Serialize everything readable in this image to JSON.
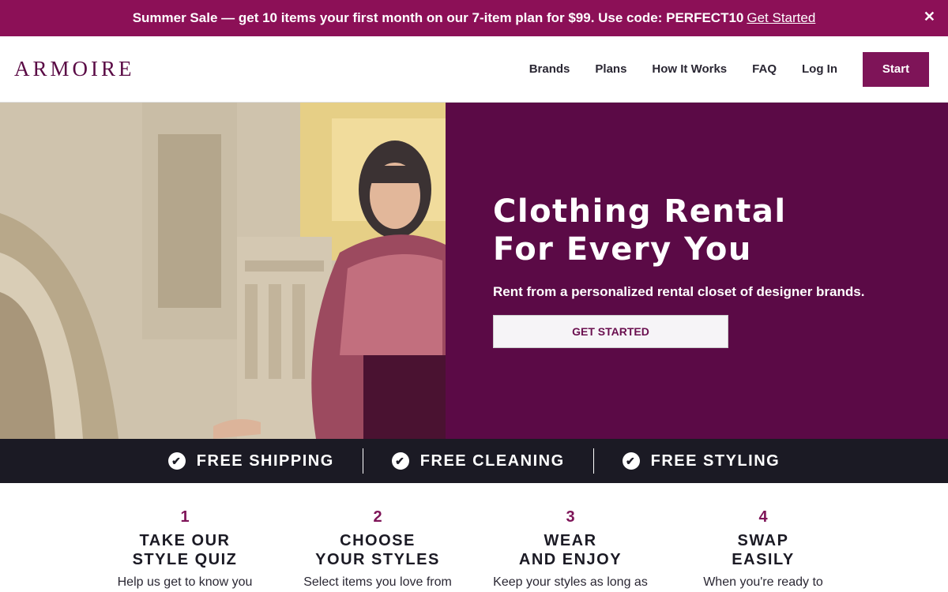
{
  "promo": {
    "text": "Summer Sale — get 10 items your first month on our 7-item plan for $99. Use code: PERFECT10",
    "link": "Get Started",
    "close": "✕"
  },
  "nav": {
    "logo": "ARMOIRE",
    "links": [
      "Brands",
      "Plans",
      "How It Works",
      "FAQ",
      "Log In"
    ],
    "start": "Start"
  },
  "hero": {
    "title_line1": "Clothing Rental",
    "title_line2": "For Every You",
    "subtitle": "Rent from a personalized rental closet of designer brands.",
    "cta": "GET STARTED"
  },
  "features": [
    "FREE SHIPPING",
    "FREE CLEANING",
    "FREE STYLING"
  ],
  "steps": [
    {
      "num": "1",
      "line1": "TAKE OUR",
      "line2": "STYLE QUIZ",
      "desc": "Help us get to know you"
    },
    {
      "num": "2",
      "line1": "CHOOSE",
      "line2": "YOUR STYLES",
      "desc": "Select items you love from"
    },
    {
      "num": "3",
      "line1": "WEAR",
      "line2": "AND ENJOY",
      "desc": "Keep your styles as long as"
    },
    {
      "num": "4",
      "line1": "SWAP",
      "line2": "EASILY",
      "desc": "When you're ready to"
    }
  ],
  "colors": {
    "brand": "#8c1057",
    "hero_bg": "#5b0a46",
    "features_bg": "#1b1a24"
  }
}
